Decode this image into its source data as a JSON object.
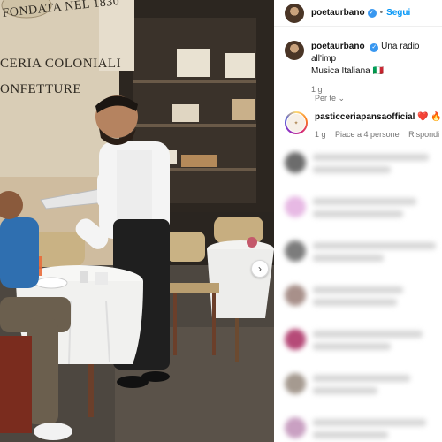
{
  "sign": {
    "fondata": "FONDATA NEL 1830",
    "line1": "CERIA COLONIALI",
    "line2": "ONFETTURE"
  },
  "carousel": {
    "next_icon": "chevron-right-icon",
    "glyph": "›"
  },
  "header": {
    "username": "poetaurbano",
    "verified_glyph": "✓",
    "separator": "•",
    "follow_label": "Segui"
  },
  "caption": {
    "username": "poetaurbano",
    "text": "Una radio all'imp",
    "text2": "Musica Italiana",
    "text2_emoji": "🇮🇹",
    "time": "1 g"
  },
  "sort_label": "Per te",
  "sort_glyph": "⌄",
  "comment": {
    "username": "pasticceriapansaofficial",
    "emoji_heart": "❤️",
    "emoji_fire": "🔥",
    "time": "1 g",
    "likes": "Piace a 4 persone",
    "reply": "Rispondi"
  },
  "colors": {
    "follow": "#0095f6",
    "verified": "#3897f0",
    "wall": "#d9cdb6",
    "tablecloth": "#f6f6f4",
    "shirt_woman": "#2f6fb0"
  }
}
